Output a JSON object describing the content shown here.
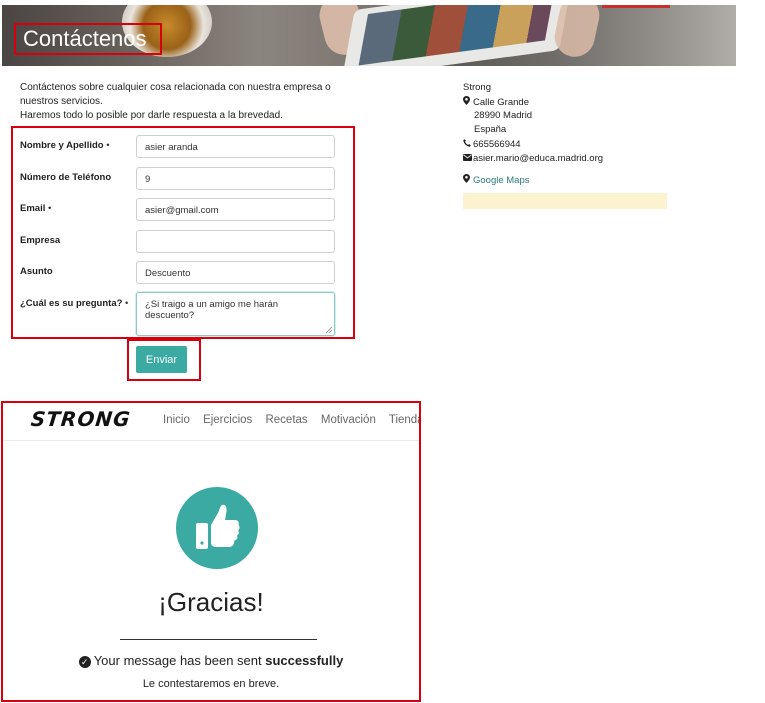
{
  "banner": {
    "title": "Contáctenos"
  },
  "intro": {
    "line1": "Contáctenos sobre cualquier cosa relacionada con nuestra empresa o",
    "line2": "nuestros servicios.",
    "line3": "Haremos todo lo posible por darle respuesta a la brevedad."
  },
  "form": {
    "required_mark": "•",
    "fields": [
      {
        "label": "Nombre y Apellido",
        "required": true,
        "value": "asier aranda"
      },
      {
        "label": "Número de Teléfono",
        "required": false,
        "value": "9"
      },
      {
        "label": "Email",
        "required": true,
        "value": "asier@gmail.com"
      },
      {
        "label": "Empresa",
        "required": false,
        "value": ""
      },
      {
        "label": "Asunto",
        "required": false,
        "value": "Descuento"
      },
      {
        "label": "¿Cuál es su pregunta?",
        "required": true,
        "value": "¿Si traigo a un amigo me harán descuento?"
      }
    ],
    "submit_label": "Enviar"
  },
  "address": {
    "company": "Strong",
    "street": "Calle Grande",
    "city": "28990 Madrid",
    "country": "España",
    "phone": "665566944",
    "email": "asier.mario@educa.madrid.org",
    "maps_link": "Google Maps"
  },
  "thanks": {
    "logo": "STRONG",
    "nav": [
      "Inicio",
      "Ejercicios",
      "Recetas",
      "Motivación",
      "Tienda"
    ],
    "heading": "¡Gracias!",
    "message_prefix": "Your message has been sent",
    "message_bold": "successfully",
    "subtext": "Le contestaremos en breve."
  },
  "colors": {
    "accent": "#3aaaa2",
    "highlight_border": "#d9000d",
    "alert_bg": "#fdf2cf"
  }
}
